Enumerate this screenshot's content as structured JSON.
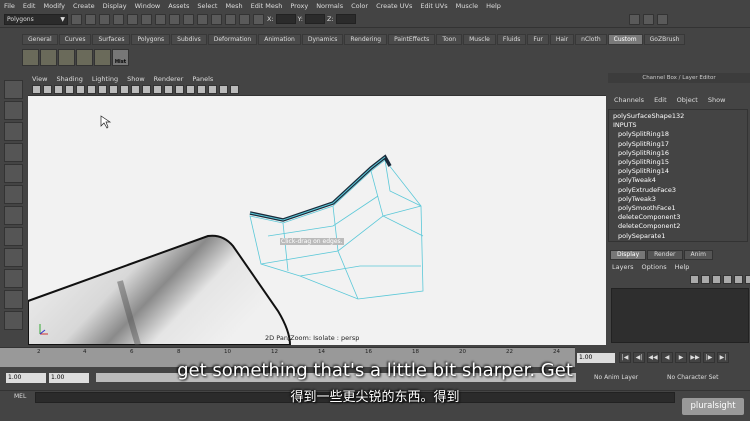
{
  "menubar": [
    "File",
    "Edit",
    "Modify",
    "Create",
    "Display",
    "Window",
    "Assets",
    "Select",
    "Mesh",
    "Edit Mesh",
    "Proxy",
    "Normals",
    "Color",
    "Create UVs",
    "Edit UVs",
    "Muscle",
    "Help"
  ],
  "status": {
    "mode": "Polygons",
    "x_label": "X:",
    "y_label": "Y:",
    "z_label": "Z:"
  },
  "shelf": {
    "tabs": [
      "General",
      "Curves",
      "Surfaces",
      "Polygons",
      "Subdivs",
      "Deformation",
      "Animation",
      "Dynamics",
      "Rendering",
      "PaintEffects",
      "Toon",
      "Muscle",
      "Fluids",
      "Fur",
      "Hair",
      "nCloth",
      "Custom",
      "GoZBrush"
    ],
    "active_tab": "Custom",
    "hist_label": "Hist"
  },
  "panel": {
    "menu": [
      "View",
      "Shading",
      "Lighting",
      "Show",
      "Renderer",
      "Panels"
    ],
    "tooltip": "Click-drag on edges.",
    "status": "2D Pan/Zoom: Isolate : persp"
  },
  "channel_box": {
    "title": "Channel Box / Layer Editor",
    "menu": [
      "Channels",
      "Edit",
      "Object",
      "Show"
    ],
    "shape": "polySurfaceShape132",
    "inputs_label": "INPUTS",
    "inputs": [
      "polySplitRing18",
      "polySplitRing17",
      "polySplitRing16",
      "polySplitRing15",
      "polySplitRing14",
      "polyTweak4",
      "polyExtrudeFace3",
      "polyTweak3",
      "polySmoothFace1",
      "deleteComponent3",
      "deleteComponent2",
      "polySeparate1"
    ]
  },
  "layers": {
    "tabs": [
      "Display",
      "Render",
      "Anim"
    ],
    "active_tab": "Display",
    "menu": [
      "Layers",
      "Options",
      "Help"
    ]
  },
  "timeline": {
    "ticks": [
      "2",
      "4",
      "6",
      "8",
      "10",
      "12",
      "14",
      "16",
      "18",
      "20",
      "22",
      "24"
    ],
    "current_time": "1.00",
    "start": "1.00",
    "range_start": "1.00",
    "anim_layer": "No Anim Layer",
    "character_set": "No Character Set"
  },
  "playback": [
    "|◀",
    "◀|",
    "◀◀",
    "◀",
    "▶",
    "▶▶",
    "|▶",
    "▶|"
  ],
  "command": {
    "label": "MEL"
  },
  "subtitle": {
    "en": "get something that's a little bit sharper. Get",
    "zh": "得到一些更尖锐的东西。得到"
  },
  "watermark": "pluralsight"
}
